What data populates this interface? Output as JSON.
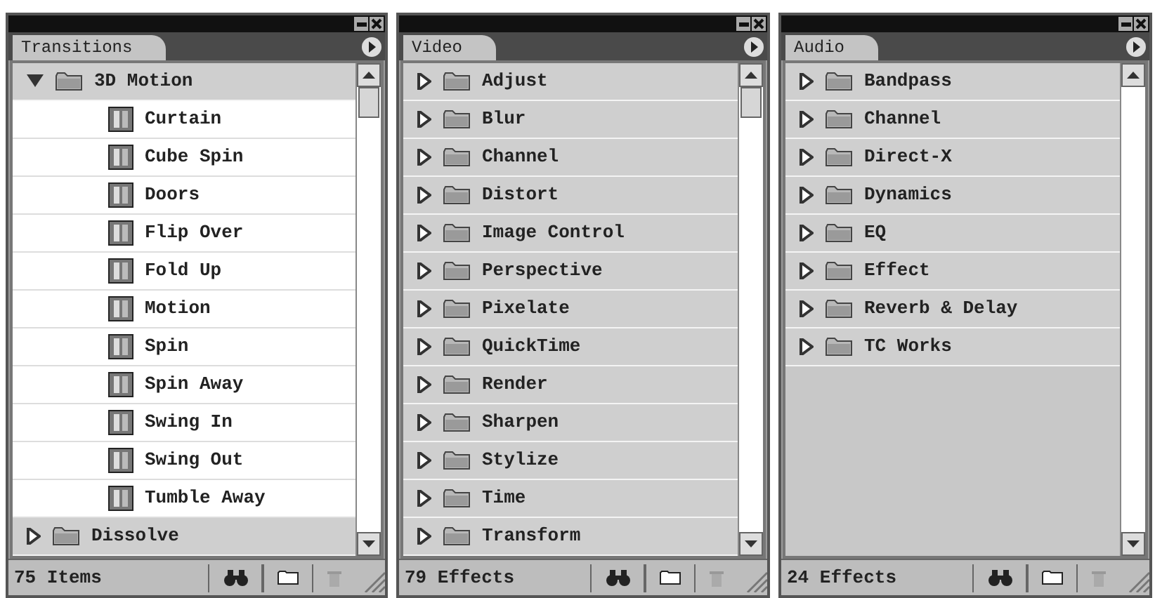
{
  "panels": [
    {
      "tab": "Transitions",
      "footer": "75 Items",
      "items": [
        {
          "label": "3D Motion",
          "expanded": true,
          "children": [
            {
              "label": "Curtain"
            },
            {
              "label": "Cube Spin"
            },
            {
              "label": "Doors"
            },
            {
              "label": "Flip Over"
            },
            {
              "label": "Fold Up"
            },
            {
              "label": "Motion"
            },
            {
              "label": "Spin"
            },
            {
              "label": "Spin Away"
            },
            {
              "label": "Swing In"
            },
            {
              "label": "Swing Out"
            },
            {
              "label": "Tumble Away"
            }
          ]
        },
        {
          "label": "Dissolve",
          "expanded": false
        }
      ]
    },
    {
      "tab": "Video",
      "footer": "79 Effects",
      "items": [
        {
          "label": "Adjust",
          "expanded": false
        },
        {
          "label": "Blur",
          "expanded": false
        },
        {
          "label": "Channel",
          "expanded": false
        },
        {
          "label": "Distort",
          "expanded": false
        },
        {
          "label": "Image Control",
          "expanded": false
        },
        {
          "label": "Perspective",
          "expanded": false
        },
        {
          "label": "Pixelate",
          "expanded": false
        },
        {
          "label": "QuickTime",
          "expanded": false
        },
        {
          "label": "Render",
          "expanded": false
        },
        {
          "label": "Sharpen",
          "expanded": false
        },
        {
          "label": "Stylize",
          "expanded": false
        },
        {
          "label": "Time",
          "expanded": false
        },
        {
          "label": "Transform",
          "expanded": false
        }
      ]
    },
    {
      "tab": "Audio",
      "footer": "24 Effects",
      "items": [
        {
          "label": "Bandpass",
          "expanded": false
        },
        {
          "label": "Channel",
          "expanded": false
        },
        {
          "label": "Direct-X",
          "expanded": false
        },
        {
          "label": "Dynamics",
          "expanded": false
        },
        {
          "label": "EQ",
          "expanded": false
        },
        {
          "label": "Effect",
          "expanded": false
        },
        {
          "label": "Reverb & Delay",
          "expanded": false
        },
        {
          "label": "TC Works",
          "expanded": false
        }
      ]
    }
  ]
}
